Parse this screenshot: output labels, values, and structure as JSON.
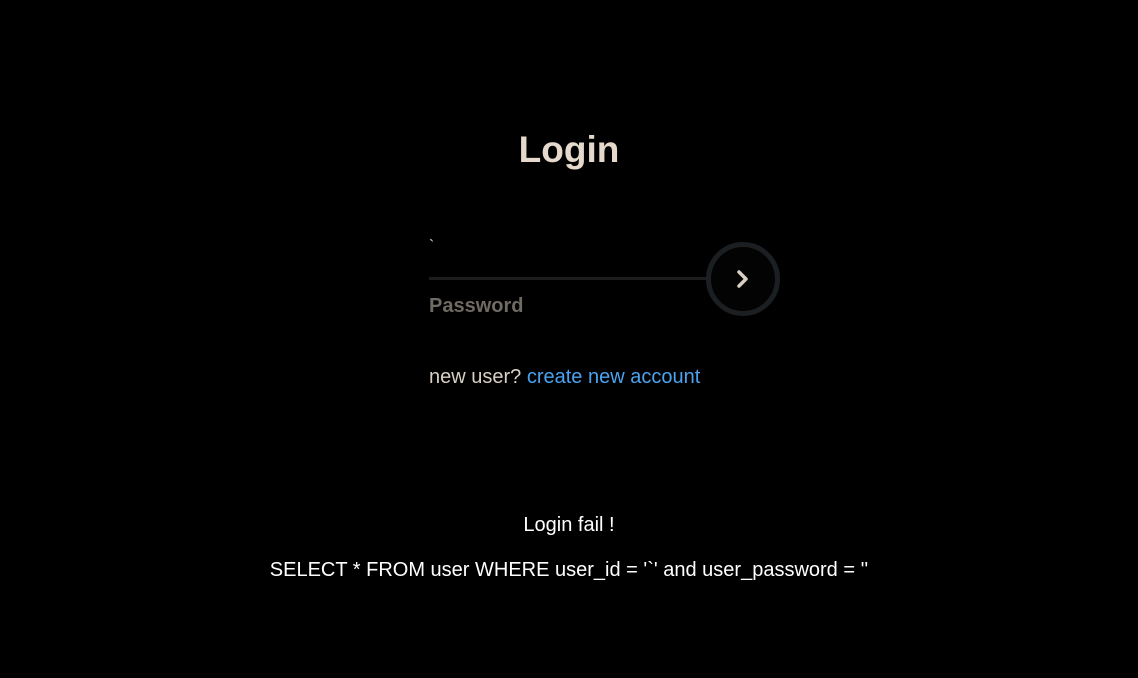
{
  "login": {
    "title": "Login",
    "username_value": "`",
    "password_placeholder": "Password",
    "signup_prompt": "new user?",
    "signup_link": "create new account",
    "submit_icon": "chevron-right-icon"
  },
  "result": {
    "message": "Login fail !",
    "query": "SELECT * FROM user WHERE user_id = '`' and user_password = ''"
  },
  "colors": {
    "background": "#000000",
    "title": "#e4d9cb",
    "link": "#4aa3ef",
    "placeholder": "#6f6a63",
    "button_ring": "#1c1f22"
  }
}
